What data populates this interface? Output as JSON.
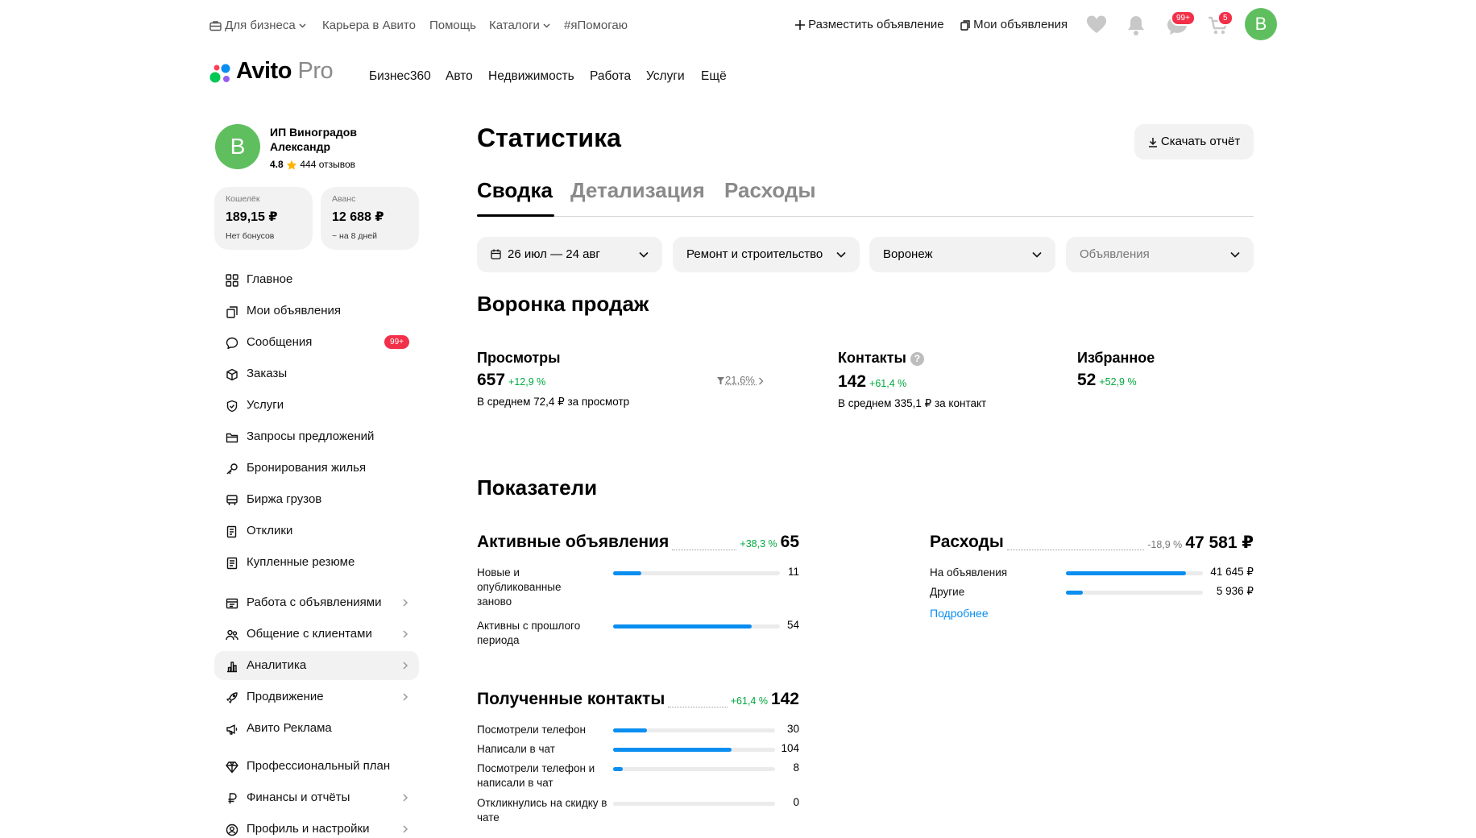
{
  "topnav": {
    "left": [
      {
        "label": "Для бизнеса",
        "icon": "briefcase-icon",
        "dropdown": true
      },
      {
        "label": "Карьера в Авито"
      },
      {
        "label": "Помощь"
      },
      {
        "label": "Каталоги",
        "dropdown": true
      },
      {
        "label": "#яПомогаю"
      }
    ],
    "post_ad": "Разместить объявление",
    "my_ads": "Мои объявления",
    "messages_badge": "99+",
    "cart_badge": "5",
    "avatar_letter": "В"
  },
  "logo": {
    "brand": "Avito",
    "suffix": "Pro"
  },
  "mainnav": [
    "Бизнес360",
    "Авто",
    "Недвижимость",
    "Работа",
    "Услуги",
    "Ещё"
  ],
  "profile": {
    "avatar_letter": "В",
    "name": "ИП Виноградов Александр",
    "rating": "4.8",
    "reviews": "444 отзывов"
  },
  "wallets": [
    {
      "title": "Кошелёк",
      "amount": "189,15 ₽",
      "note": "Нет бонусов"
    },
    {
      "title": "Аванс",
      "amount": "12 688 ₽",
      "note": "~ на 8 дней"
    }
  ],
  "sidebar": {
    "items": [
      {
        "label": "Главное",
        "icon": "grid-icon"
      },
      {
        "label": "Мои объявления",
        "icon": "copy-icon"
      },
      {
        "label": "Сообщения",
        "icon": "chat-icon",
        "badge": "99+"
      },
      {
        "label": "Заказы",
        "icon": "box-icon"
      },
      {
        "label": "Услуги",
        "icon": "shield-icon"
      },
      {
        "label": "Запросы предложений",
        "icon": "folder-icon"
      },
      {
        "label": "Бронирования жилья",
        "icon": "key-icon"
      },
      {
        "label": "Биржа грузов",
        "icon": "truck-icon"
      },
      {
        "label": "Отклики",
        "icon": "document-icon"
      },
      {
        "label": "Купленные резюме",
        "icon": "resume-icon"
      },
      {
        "label": "Работа с объявлениями",
        "icon": "ads-icon",
        "chevron": true
      },
      {
        "label": "Общение с клиентами",
        "icon": "users-icon",
        "chevron": true
      },
      {
        "label": "Аналитика",
        "icon": "analytics-icon",
        "chevron": true,
        "active": true
      },
      {
        "label": "Продвижение",
        "icon": "rocket-icon",
        "chevron": true
      },
      {
        "label": "Авито Реклама",
        "icon": "megaphone-icon"
      },
      {
        "label": "Профессиональный план",
        "icon": "diamond-icon"
      },
      {
        "label": "Финансы и отчёты",
        "icon": "ruble-icon",
        "chevron": true
      },
      {
        "label": "Профиль и настройки",
        "icon": "profile-icon",
        "chevron": true
      }
    ]
  },
  "main": {
    "title": "Статистика",
    "download": "Скачать отчёт",
    "tabs": [
      "Сводка",
      "Детализация",
      "Расходы"
    ],
    "filters": [
      {
        "label": "26 июл — 24 авг",
        "icon": "calendar-icon"
      },
      {
        "label": "Ремонт и строительство"
      },
      {
        "label": "Воронеж"
      },
      {
        "label": "Объявления",
        "placeholder": true
      }
    ],
    "funnel_title": "Воронка продаж",
    "funnel": [
      {
        "title": "Просмотры",
        "value": "657",
        "pct": "+12,9 %",
        "sub": "В среднем 72,4 ₽ за просмотр"
      },
      {
        "title": "Контакты",
        "value": "142",
        "pct": "+61,4 %",
        "sub": "В среднем 335,1 ₽ за контакт",
        "help": "?"
      },
      {
        "title": "Избранное",
        "value": "52",
        "pct": "+52,9 %"
      }
    ],
    "conversion": "21,6%",
    "indicators_title": "Показатели",
    "active_ads": {
      "title": "Активные объявления",
      "pct": "+38,3 %",
      "value": "65",
      "rows": [
        {
          "label": "Новые и опубликованные заново",
          "value": "11",
          "fraction": 0.17
        },
        {
          "label": "Активны с прошлого периода",
          "value": "54",
          "fraction": 0.83
        }
      ]
    },
    "expenses": {
      "title": "Расходы",
      "pct": "-18,9 %",
      "value": "47 581 ₽",
      "rows": [
        {
          "label": "На объявления",
          "value": "41 645 ₽",
          "fraction": 0.875
        },
        {
          "label": "Другие",
          "value": "5 936 ₽",
          "fraction": 0.125
        }
      ],
      "more": "Подробнее"
    },
    "contacts": {
      "title": "Полученные контакты",
      "pct": "+61,4 %",
      "value": "142",
      "rows": [
        {
          "label": "Посмотрели телефон",
          "value": "30",
          "fraction": 0.21
        },
        {
          "label": "Написали в чат",
          "value": "104",
          "fraction": 0.73
        },
        {
          "label": "Посмотрели телефон и написали в чат",
          "value": "8",
          "fraction": 0.06
        },
        {
          "label": "Откликнулись на скидку в чате",
          "value": "0",
          "fraction": 0
        }
      ]
    }
  }
}
